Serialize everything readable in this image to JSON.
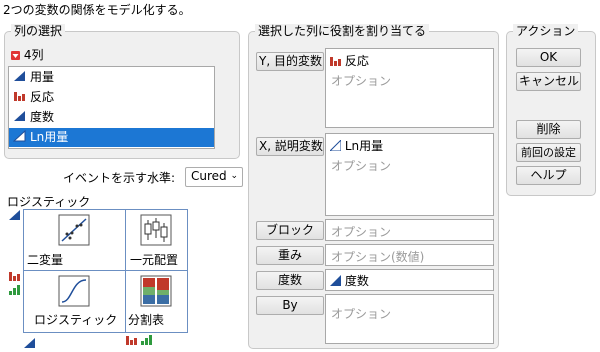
{
  "header": {
    "title": "2つの変数の関係をモデル化する。"
  },
  "column_select": {
    "title": "列の選択",
    "count_label": "4列",
    "columns": [
      {
        "label": "用量",
        "icon": "continuous-icon",
        "selected": false
      },
      {
        "label": "反応",
        "icon": "nominal-icon",
        "selected": false
      },
      {
        "label": "度数",
        "icon": "continuous-icon",
        "selected": false
      },
      {
        "label": "Ln用量",
        "icon": "continuous-icon",
        "selected": true
      }
    ]
  },
  "event_level": {
    "label": "イベントを示す水準:",
    "value": "Cured"
  },
  "platform_map": {
    "title": "ロジスティック",
    "tiles": {
      "bivariate": "二変量",
      "oneway": "一元配置",
      "logistic": "ロジスティック",
      "contingency": "分割表"
    }
  },
  "role_panel": {
    "title": "選択した列に役割を割り当てる",
    "roles": {
      "y": {
        "button": "Y, 目的変数",
        "value": "反応",
        "placeholder": "オプション"
      },
      "x": {
        "button": "X, 説明変数",
        "value": "Ln用量",
        "placeholder": "オプション"
      },
      "block": {
        "button": "ブロック",
        "placeholder": "オプション"
      },
      "weight": {
        "button": "重み",
        "placeholder": "オプション(数値)"
      },
      "freq": {
        "button": "度数",
        "value": "度数"
      },
      "by": {
        "button": "By",
        "placeholder": "オプション"
      }
    }
  },
  "actions": {
    "title": "アクション",
    "ok": "OK",
    "cancel": "キャンセル",
    "remove": "削除",
    "recall": "前回の設定",
    "help": "ヘルプ"
  },
  "colors": {
    "selection": "#1c77d4",
    "continuous_icon": "#1f4e9a",
    "nominal_icon": "#c0392b",
    "ordinal_icon": "#2e9a3e",
    "tile_border": "#6b8fc2"
  }
}
